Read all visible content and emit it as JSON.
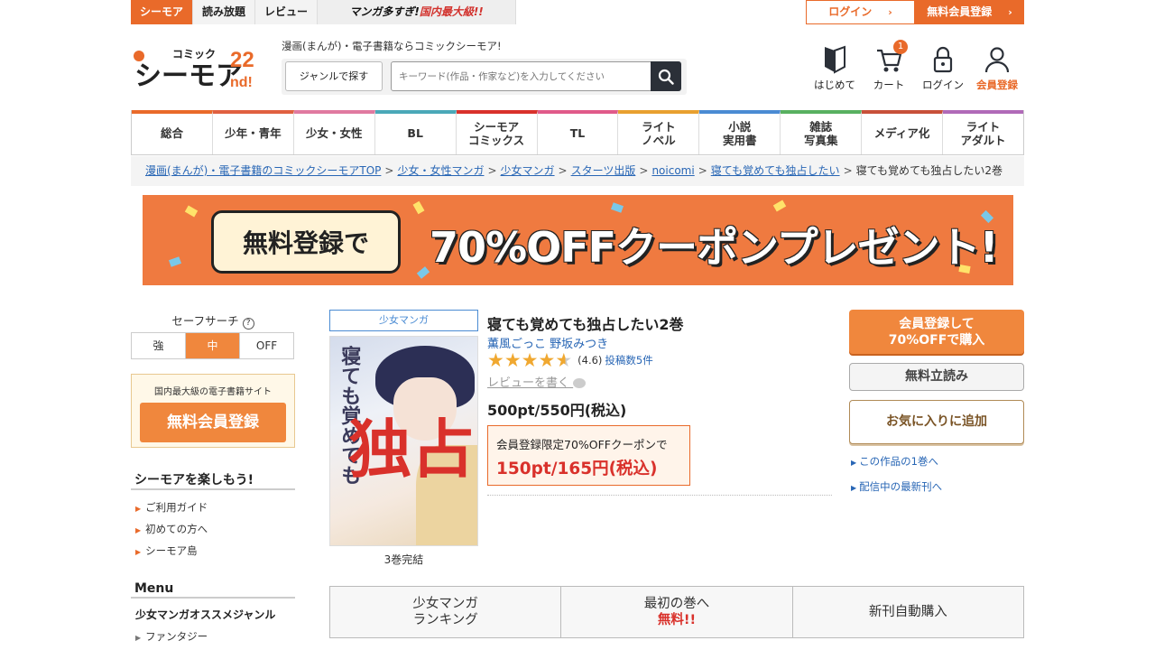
{
  "topbar": {
    "tabs": [
      {
        "label": "シーモア",
        "active": true
      },
      {
        "label": "読み放題"
      },
      {
        "label": "レビュー"
      }
    ],
    "promo_black": "マンガ多すぎ!",
    "promo_red": "国内最大級!!",
    "login_label": "ログイン",
    "register_label": "無料会員登録"
  },
  "header": {
    "logo_text": "シーモア",
    "logo_small": "コミック",
    "logo_badge": "22nd!",
    "tagline": "漫画(まんが)・電子書籍ならコミックシーモア!",
    "genre_button": "ジャンルで探す",
    "search_placeholder": "キーワード(作品・作家など)を入力してください",
    "icons": [
      {
        "label": "はじめて",
        "icon": "beginner-icon"
      },
      {
        "label": "カート",
        "icon": "cart-icon",
        "badge": "1"
      },
      {
        "label": "ログイン",
        "icon": "lock-icon"
      },
      {
        "label": "会員登録",
        "icon": "user-icon"
      }
    ]
  },
  "nav": {
    "categories": [
      {
        "label": "総合",
        "color": "#e96a2a"
      },
      {
        "label": "少年・青年",
        "color": "#e06040"
      },
      {
        "label": "少女・女性",
        "color": "#e07aa0"
      },
      {
        "label": "BL",
        "color": "#4aa8b8"
      },
      {
        "label": "シーモア\nコミックス",
        "color": "#d9312b"
      },
      {
        "label": "TL",
        "color": "#e05a8a"
      },
      {
        "label": "ライト\nノベル",
        "color": "#e8a030"
      },
      {
        "label": "小説\n実用書",
        "color": "#4a8bd3"
      },
      {
        "label": "雑誌\n写真集",
        "color": "#58b060"
      },
      {
        "label": "メディア化",
        "color": "#c8503a"
      },
      {
        "label": "ライト\nアダルト",
        "color": "#b06ab8"
      }
    ]
  },
  "breadcrumb": {
    "links": [
      "漫画(まんが)・電子書籍のコミックシーモアTOP",
      "少女・女性マンガ",
      "少女マンガ",
      "スターツ出版",
      "noicomi",
      "寝ても覚めても独占したい"
    ],
    "current": "寝ても覚めても独占したい2巻"
  },
  "banner": {
    "pill_text": "無料登録で",
    "main_text": "70%OFFクーポンプレゼント!"
  },
  "sidebar": {
    "safe_search_label": "セーフサーチ",
    "safe_options": [
      "強",
      "中",
      "OFF"
    ],
    "safe_selected": "中",
    "free_box_caption": "国内最大級の電子書籍サイト",
    "free_box_button": "無料会員登録",
    "enjoy_heading": "シーモアを楽しもう!",
    "enjoy_links": [
      "ご利用ガイド",
      "初めての方へ",
      "シーモア島"
    ],
    "menu_heading": "Menu",
    "menu_subheading": "少女マンガオススメジャンル",
    "menu_links": [
      "ファンタジー"
    ]
  },
  "product": {
    "category_tag": "少女マンガ",
    "cover_title": "寝ても覚めても",
    "cover_big": "独占",
    "volume_status": "3巻完結",
    "title": "寝ても覚めても独占したい2巻",
    "authors": [
      "薫風ごっこ",
      "野坂みつき"
    ],
    "rating": 4.6,
    "rating_text": "(4.6)",
    "review_count_text": "投稿数5件",
    "write_review": "レビューを書く",
    "price": "500pt/550円(税込)",
    "coupon_text": "会員登録限定70%OFFクーポンで",
    "coupon_price": "150pt/165円(税込)"
  },
  "actions": {
    "buy_line1": "会員登録して",
    "buy_line2": "70%OFFで購入",
    "read_free": "無料立読み",
    "add_favorite": "お気に入りに追加",
    "link_first_volume": "この作品の1巻へ",
    "link_latest": "配信中の最新刊へ"
  },
  "bottom_tabs": [
    {
      "line1": "少女マンガ",
      "line2": "ランキング"
    },
    {
      "line1": "最初の巻へ",
      "line2": "無料!!"
    },
    {
      "line1": "新刊自動購入"
    }
  ]
}
